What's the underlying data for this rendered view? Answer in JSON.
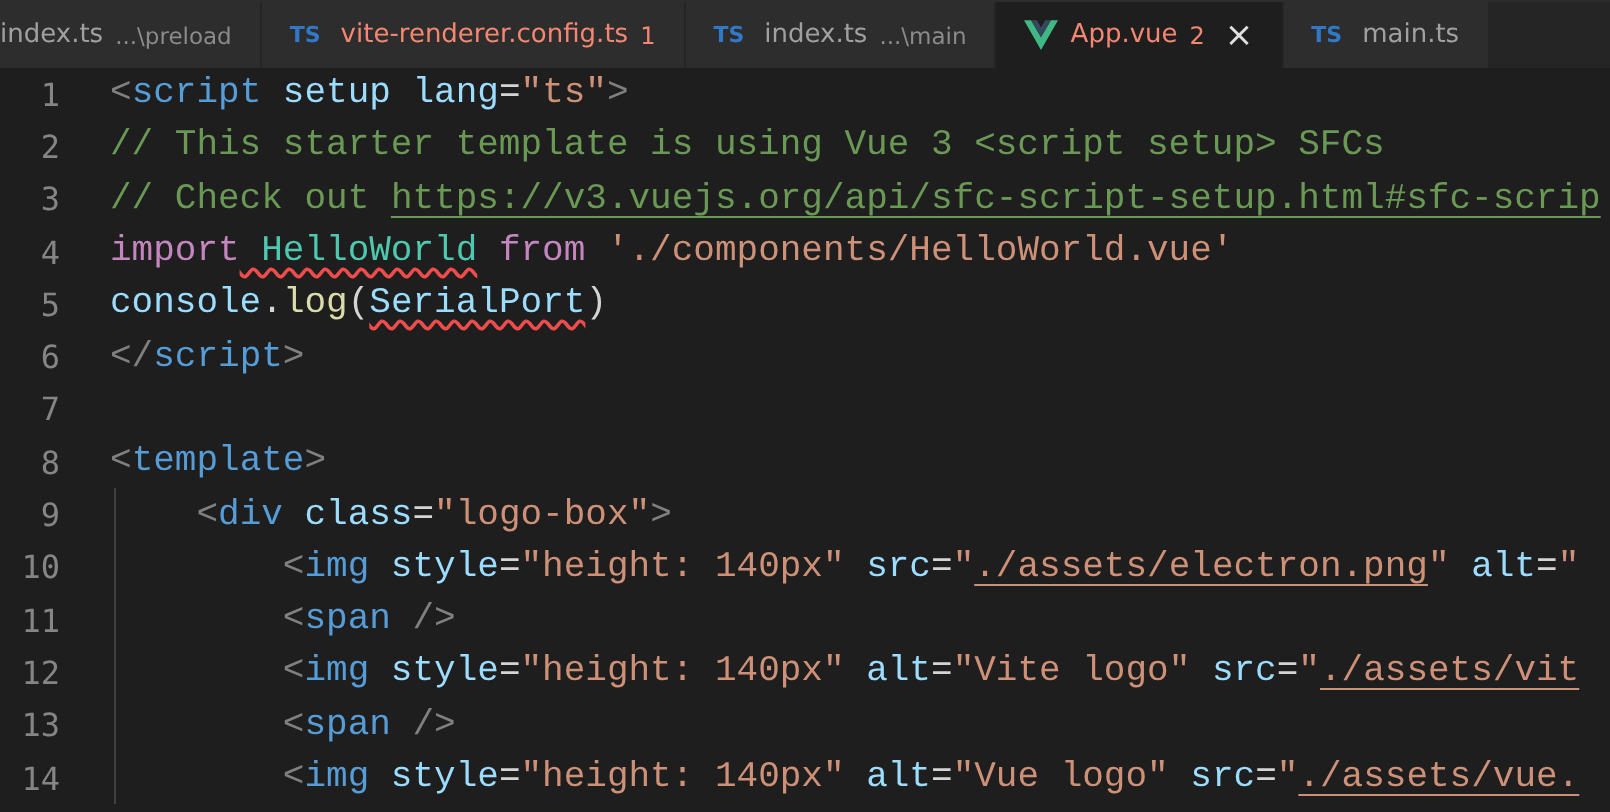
{
  "tabs": [
    {
      "kind": "plain",
      "label": "index.ts",
      "detail": "...\\preload",
      "has_errors": false,
      "selected": false
    },
    {
      "kind": "ts",
      "badge": "TS",
      "label": "vite-renderer.config.ts",
      "errors": "1",
      "has_errors": true,
      "selected": false
    },
    {
      "kind": "ts",
      "badge": "TS",
      "label": "index.ts",
      "detail": "...\\main",
      "has_errors": false,
      "selected": false
    },
    {
      "kind": "vue",
      "label": "App.vue",
      "errors": "2",
      "close": "×",
      "has_errors": true,
      "selected": true
    },
    {
      "kind": "ts",
      "badge": "TS",
      "label": "main.ts",
      "has_errors": false,
      "selected": false
    }
  ],
  "editor": {
    "lines": [
      {
        "number": "1",
        "tokens": [
          {
            "kind": "punct",
            "text": "<"
          },
          {
            "kind": "tag",
            "text": "script"
          },
          {
            "kind": "attr",
            "text": " setup"
          },
          {
            "kind": "attr",
            "text": " lang"
          },
          {
            "kind": "text",
            "text": "="
          },
          {
            "kind": "string",
            "text": "\"ts\""
          },
          {
            "kind": "punct",
            "text": ">"
          }
        ]
      },
      {
        "number": "2",
        "tokens": [
          {
            "kind": "comment",
            "text": "// This starter template is using Vue 3 <script setup> SFCs"
          }
        ]
      },
      {
        "number": "3",
        "tokens": [
          {
            "kind": "comment",
            "text": "// Check out "
          },
          {
            "kind": "comment-link",
            "text": "https://v3.vuejs.org/api/sfc-script-setup.html#sfc-scrip"
          }
        ]
      },
      {
        "number": "4",
        "tokens": [
          {
            "kind": "keyword",
            "text": "import"
          },
          {
            "kind": "type",
            "text": " HelloWorld",
            "error": true
          },
          {
            "kind": "keyword",
            "text": " from"
          },
          {
            "kind": "string",
            "text": " './components/HelloWorld.vue'"
          }
        ]
      },
      {
        "number": "5",
        "tokens": [
          {
            "kind": "var",
            "text": "console"
          },
          {
            "kind": "text",
            "text": "."
          },
          {
            "kind": "func",
            "text": "log"
          },
          {
            "kind": "text",
            "text": "("
          },
          {
            "kind": "var",
            "text": "SerialPort",
            "error": true
          },
          {
            "kind": "text",
            "text": ")"
          }
        ]
      },
      {
        "number": "6",
        "tokens": [
          {
            "kind": "punct",
            "text": "</"
          },
          {
            "kind": "tag",
            "text": "script"
          },
          {
            "kind": "punct",
            "text": ">"
          }
        ]
      },
      {
        "number": "7"
      },
      {
        "number": "8",
        "tokens": [
          {
            "kind": "punct",
            "text": "<"
          },
          {
            "kind": "tag",
            "text": "template"
          },
          {
            "kind": "punct",
            "text": ">"
          }
        ]
      },
      {
        "number": "9",
        "tokens": [
          {
            "kind": "punct",
            "text": "    <"
          },
          {
            "kind": "tag",
            "text": "div"
          },
          {
            "kind": "attr",
            "text": " class"
          },
          {
            "kind": "text",
            "text": "="
          },
          {
            "kind": "string",
            "text": "\"logo-box\""
          },
          {
            "kind": "punct",
            "text": ">"
          }
        ]
      },
      {
        "number": "10",
        "tokens": [
          {
            "kind": "punct",
            "text": "        <"
          },
          {
            "kind": "tag",
            "text": "img"
          },
          {
            "kind": "attr",
            "text": " style"
          },
          {
            "kind": "text",
            "text": "="
          },
          {
            "kind": "string",
            "text": "\"height: 140px\""
          },
          {
            "kind": "attr",
            "text": " src"
          },
          {
            "kind": "text",
            "text": "="
          },
          {
            "kind": "string",
            "text": "\""
          },
          {
            "kind": "string-link",
            "text": "./assets/electron.png"
          },
          {
            "kind": "string",
            "text": "\""
          },
          {
            "kind": "attr",
            "text": " alt"
          },
          {
            "kind": "text",
            "text": "="
          },
          {
            "kind": "string",
            "text": "\""
          }
        ]
      },
      {
        "number": "11",
        "tokens": [
          {
            "kind": "punct",
            "text": "        <"
          },
          {
            "kind": "tag",
            "text": "span"
          },
          {
            "kind": "punct",
            "text": " />"
          }
        ]
      },
      {
        "number": "12",
        "tokens": [
          {
            "kind": "punct",
            "text": "        <"
          },
          {
            "kind": "tag",
            "text": "img"
          },
          {
            "kind": "attr",
            "text": " style"
          },
          {
            "kind": "text",
            "text": "="
          },
          {
            "kind": "string",
            "text": "\"height: 140px\""
          },
          {
            "kind": "attr",
            "text": " alt"
          },
          {
            "kind": "text",
            "text": "="
          },
          {
            "kind": "string",
            "text": "\"Vite logo\""
          },
          {
            "kind": "attr",
            "text": " src"
          },
          {
            "kind": "text",
            "text": "="
          },
          {
            "kind": "string",
            "text": "\""
          },
          {
            "kind": "string-link",
            "text": "./assets/vit"
          }
        ]
      },
      {
        "number": "13",
        "tokens": [
          {
            "kind": "punct",
            "text": "        <"
          },
          {
            "kind": "tag",
            "text": "span"
          },
          {
            "kind": "punct",
            "text": " />"
          }
        ]
      },
      {
        "number": "14",
        "tokens": [
          {
            "kind": "punct",
            "text": "        <"
          },
          {
            "kind": "tag",
            "text": "img"
          },
          {
            "kind": "attr",
            "text": " style"
          },
          {
            "kind": "text",
            "text": "="
          },
          {
            "kind": "string",
            "text": "\"height: 140px\""
          },
          {
            "kind": "attr",
            "text": " alt"
          },
          {
            "kind": "text",
            "text": "="
          },
          {
            "kind": "string",
            "text": "\"Vue logo\""
          },
          {
            "kind": "attr",
            "text": " src"
          },
          {
            "kind": "text",
            "text": "="
          },
          {
            "kind": "string",
            "text": "\""
          },
          {
            "kind": "string-link",
            "text": "./assets/vue."
          }
        ]
      }
    ]
  }
}
